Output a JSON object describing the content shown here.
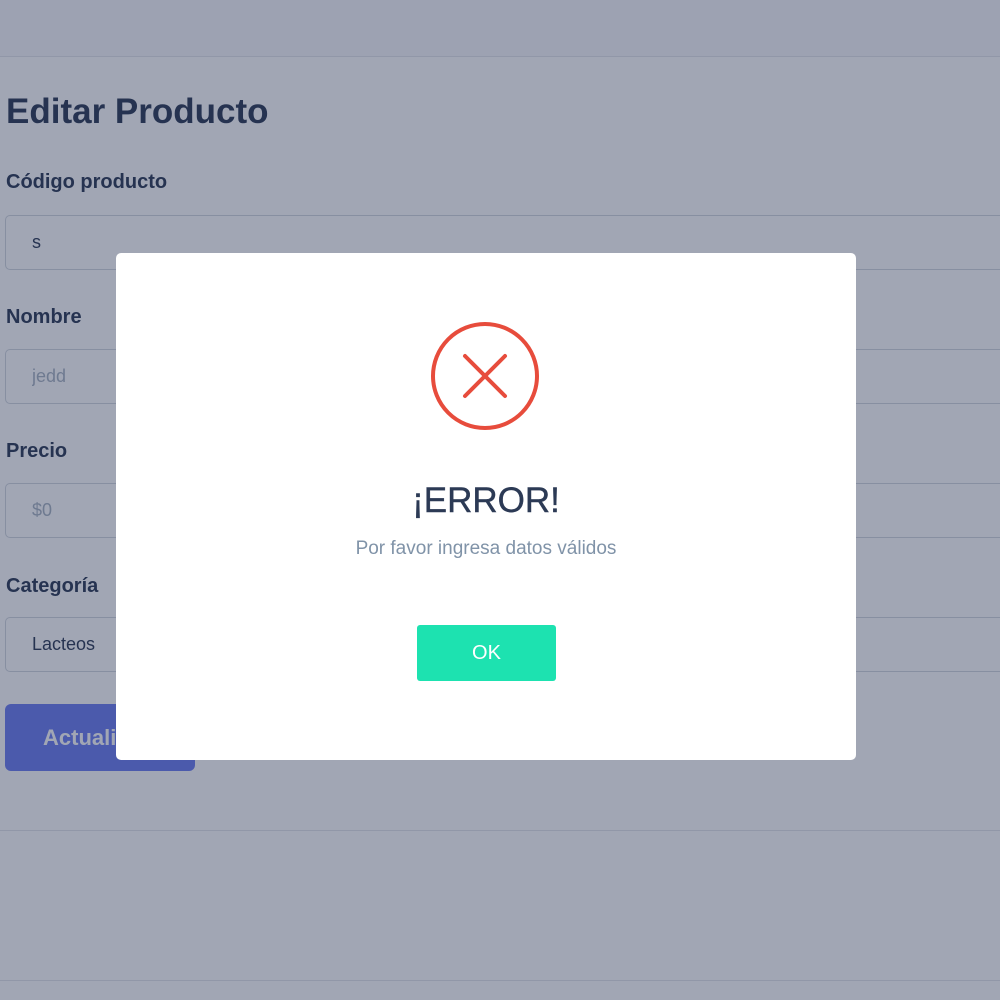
{
  "form": {
    "title": "Editar Producto",
    "code": {
      "label": "Código producto",
      "value": "s"
    },
    "name": {
      "label": "Nombre",
      "placeholder": "jedd"
    },
    "price": {
      "label": "Precio",
      "placeholder": "$0"
    },
    "category": {
      "label": "Categoría",
      "selected": "Lacteos"
    },
    "submit_label": "Actualizar"
  },
  "modal": {
    "icon": "error-x-circle",
    "title": "¡ERROR!",
    "message": "Por favor ingresa datos válidos",
    "ok_label": "OK"
  },
  "colors": {
    "error_red": "#e74c3c",
    "ok_button": "#1de2b0",
    "primary_button": "#6c7cf1",
    "text_dark": "#2c3a55"
  }
}
